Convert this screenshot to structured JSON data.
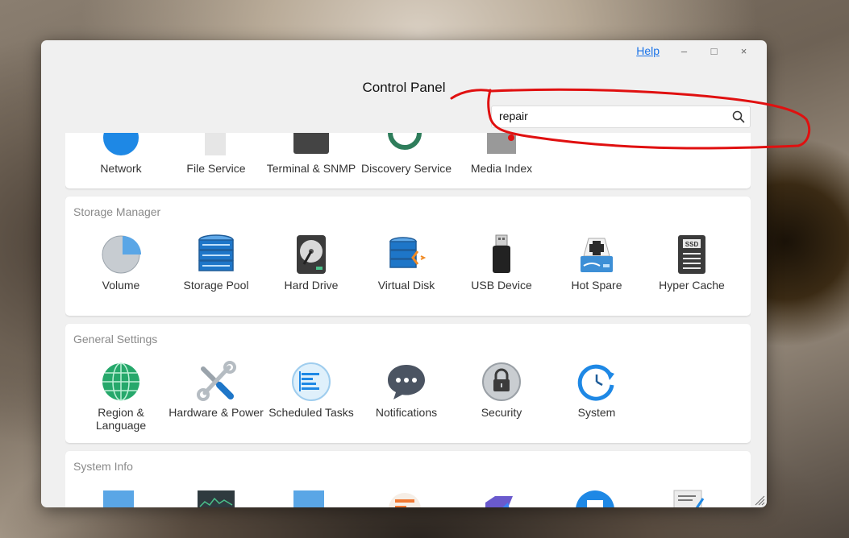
{
  "window": {
    "title": "Control Panel",
    "help_label": "Help",
    "minimize_label": "–",
    "maximize_label": "□",
    "close_label": "×"
  },
  "search": {
    "value": "repair",
    "icon": "search-icon"
  },
  "sections": {
    "network": {
      "items": [
        "Network",
        "File Service",
        "Terminal & SNMP",
        "Discovery Service",
        "Media Index"
      ]
    },
    "storage": {
      "title": "Storage Manager",
      "items": [
        "Volume",
        "Storage Pool",
        "Hard Drive",
        "Virtual Disk",
        "USB Device",
        "Hot Spare",
        "Hyper Cache"
      ]
    },
    "general": {
      "title": "General Settings",
      "items": [
        "Region & Language",
        "Hardware & Power",
        "Scheduled Tasks",
        "Notifications",
        "Security",
        "System"
      ]
    },
    "sysinfo": {
      "title": "System Info"
    }
  },
  "icons": {
    "ssd_label": "SSD"
  },
  "colors": {
    "accent_blue": "#1e88e5",
    "help_link": "#1a73e8",
    "annotation_red": "#e01010"
  }
}
